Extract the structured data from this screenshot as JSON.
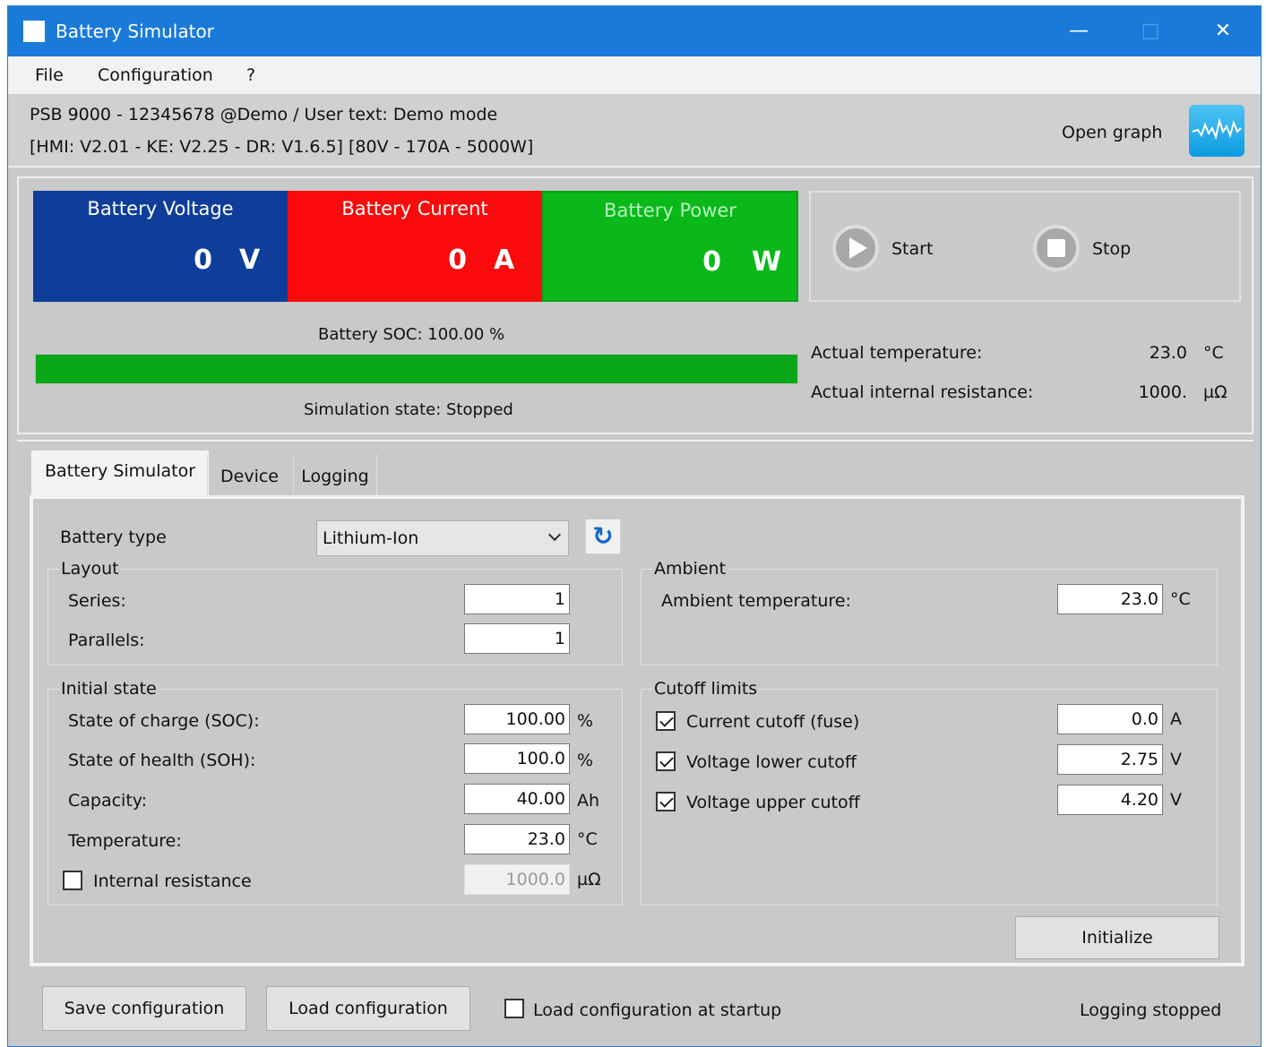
{
  "window": {
    "title": "Battery Simulator",
    "minimize": "—",
    "maximize": "□",
    "close": "✕"
  },
  "menu": [
    "File",
    "Configuration",
    "?"
  ],
  "info": {
    "line1": "PSB 9000 - 12345678 @Demo / User text: Demo mode",
    "line2": "[HMI: V2.01 - KE: V2.25 - DR: V1.6.5] [80V - 170A - 5000W]",
    "open_graph": "Open graph"
  },
  "tiles": {
    "voltage": {
      "label": "Battery Voltage",
      "value": "0",
      "unit": "V",
      "color": "#0e3e99"
    },
    "current": {
      "label": "Battery Current",
      "value": "0",
      "unit": "A",
      "color": "#fa0a0a"
    },
    "power": {
      "label": "Battery Power",
      "value": "0",
      "unit": "W",
      "color": "#0ab81a"
    }
  },
  "controls": {
    "start": "Start",
    "stop": "Stop"
  },
  "soc": {
    "label": "Battery SOC: 100.00 %",
    "percent": 100
  },
  "simulation_state": "Simulation state: Stopped",
  "actual": {
    "temp_label": "Actual temperature:",
    "temp_value": "23.0",
    "temp_unit": "°C",
    "res_label": "Actual internal resistance:",
    "res_value": "1000.",
    "res_unit": "µΩ"
  },
  "tabs": [
    "Battery Simulator",
    "Device",
    "Logging"
  ],
  "battery_type": {
    "label": "Battery type",
    "value": "Lithium-Ion"
  },
  "layout": {
    "title": "Layout",
    "series_label": "Series:",
    "series_value": "1",
    "parallels_label": "Parallels:",
    "parallels_value": "1"
  },
  "ambient": {
    "title": "Ambient",
    "temp_label": "Ambient temperature:",
    "temp_value": "23.0",
    "temp_unit": "°C"
  },
  "initial_state": {
    "title": "Initial state",
    "soc_label": "State of charge (SOC):",
    "soc_value": "100.00",
    "soc_unit": "%",
    "soh_label": "State of health (SOH):",
    "soh_value": "100.0",
    "soh_unit": "%",
    "cap_label": "Capacity:",
    "cap_value": "40.00",
    "cap_unit": "Ah",
    "temp_label": "Temperature:",
    "temp_value": "23.0",
    "temp_unit": "°C",
    "res_label": "Internal resistance",
    "res_value": "1000.0",
    "res_unit": "µΩ",
    "res_checked": false
  },
  "cutoff": {
    "title": "Cutoff limits",
    "current_label": "Current cutoff (fuse)",
    "current_value": "0.0",
    "current_unit": "A",
    "vlow_label": "Voltage lower cutoff",
    "vlow_value": "2.75",
    "vlow_unit": "V",
    "vhigh_label": "Voltage upper cutoff",
    "vhigh_value": "4.20",
    "vhigh_unit": "V"
  },
  "initialize": "Initialize",
  "footer": {
    "save": "Save configuration",
    "load": "Load configuration",
    "load_startup": "Load configuration at startup",
    "logging_status": "Logging stopped"
  }
}
